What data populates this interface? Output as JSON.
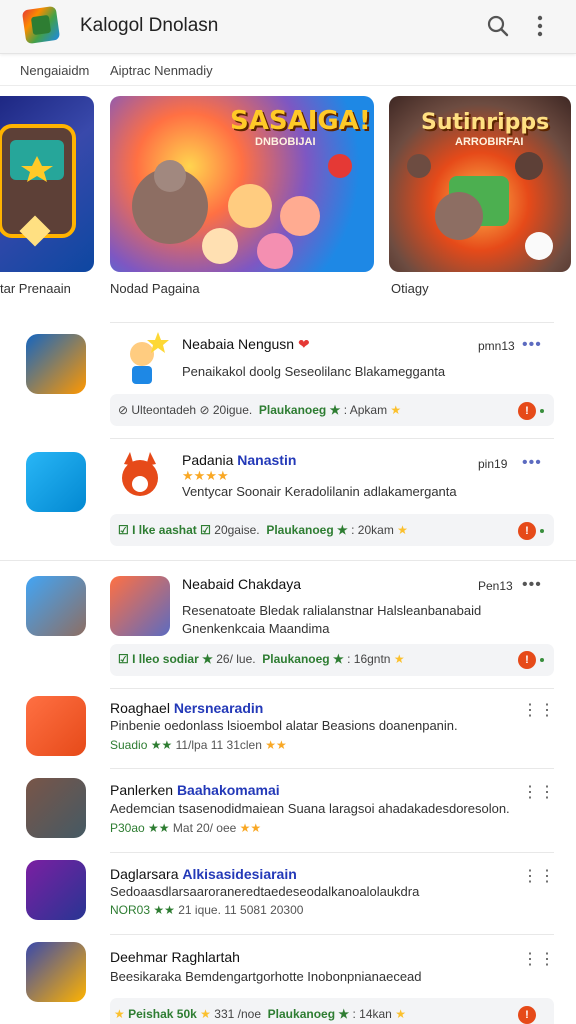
{
  "app": {
    "title": "Kalogol Dnolasn"
  },
  "icons": {
    "logo": "app-logo-icon",
    "search": "search-icon",
    "more": "more-vert-icon"
  },
  "subtabs": [
    "Nengaiaidm",
    "Aiptrac Nenmadiy"
  ],
  "carousel": [
    {
      "title": "",
      "label": "tar Prenaain"
    },
    {
      "title": "SASAIGA!",
      "subtitle": "DNBOBIJAI",
      "label": "Nodad Pagaina"
    },
    {
      "title": "Sutinripps",
      "subtitle": "ARROBIRFAI",
      "label": "Otiagy"
    }
  ],
  "rows": [
    {
      "title": "Neabaia Nengusn",
      "count": "pmn13",
      "desc": "Penaikakol doolg Seseolilanc Blakamegganta",
      "meta": {
        "a": "Ulteontadeh",
        "b": "20igue.",
        "c": "Plaukanoeg",
        "d": "Apkam"
      }
    },
    {
      "title_plain": "Padania",
      "title_hl": "Nanastin",
      "count": "pin19",
      "desc": "Ventycar Soonair Keradolilanin adlakamerganta",
      "meta": {
        "a": "I lke aashat",
        "b": "20gaise.",
        "c": "Plaukanoeg",
        "d": "20kam"
      }
    },
    {
      "title": "Neabaid Chakdaya",
      "count": "Pen13",
      "desc": "Resenatoate Bledak ralialanstnar Halsleanbanabaid",
      "desc2": "Gnenkenkcaia Maandima",
      "meta": {
        "a": "I lleo sodiar",
        "b": "26/ lue.",
        "c": "Plaukanoeg",
        "d": "16gntn"
      }
    },
    {
      "title_plain": "Roaghael",
      "title_hl": "Nersnearadin",
      "desc": "Pinbenie oedonlass lsioembol alatar Beasions doanenpanin.",
      "meta": {
        "a": "Suadio",
        "b": "11/lpa",
        "c": "11 31clen"
      }
    },
    {
      "title_plain": "Panlerken",
      "title_hl": "Baahakomamai",
      "desc": "Aedemcian tsasenodidmaiean Suana laragsoi ahadakadesdoresolon.",
      "meta": {
        "a": "P30ao",
        "b": "Mat",
        "c": "20/ oee"
      }
    },
    {
      "title_plain": "Daglarsara",
      "title_hl": "Alkisasidesiarain",
      "desc": "Sedoaasdlarsaaroraneredtaedeseodalkanoalolaukdra",
      "meta": {
        "a": "NOR03",
        "b": "21 ique.",
        "c": "11 5081 20300"
      }
    },
    {
      "title": "Deehmar Raghlartah",
      "desc": "Beesikaraka Bemdengartgorhotte Inobonpnianaecead",
      "meta": {
        "a": "Peishak 50k",
        "b": "331 /noe",
        "c": "Plaukanoeg",
        "d": "14kan"
      }
    }
  ]
}
